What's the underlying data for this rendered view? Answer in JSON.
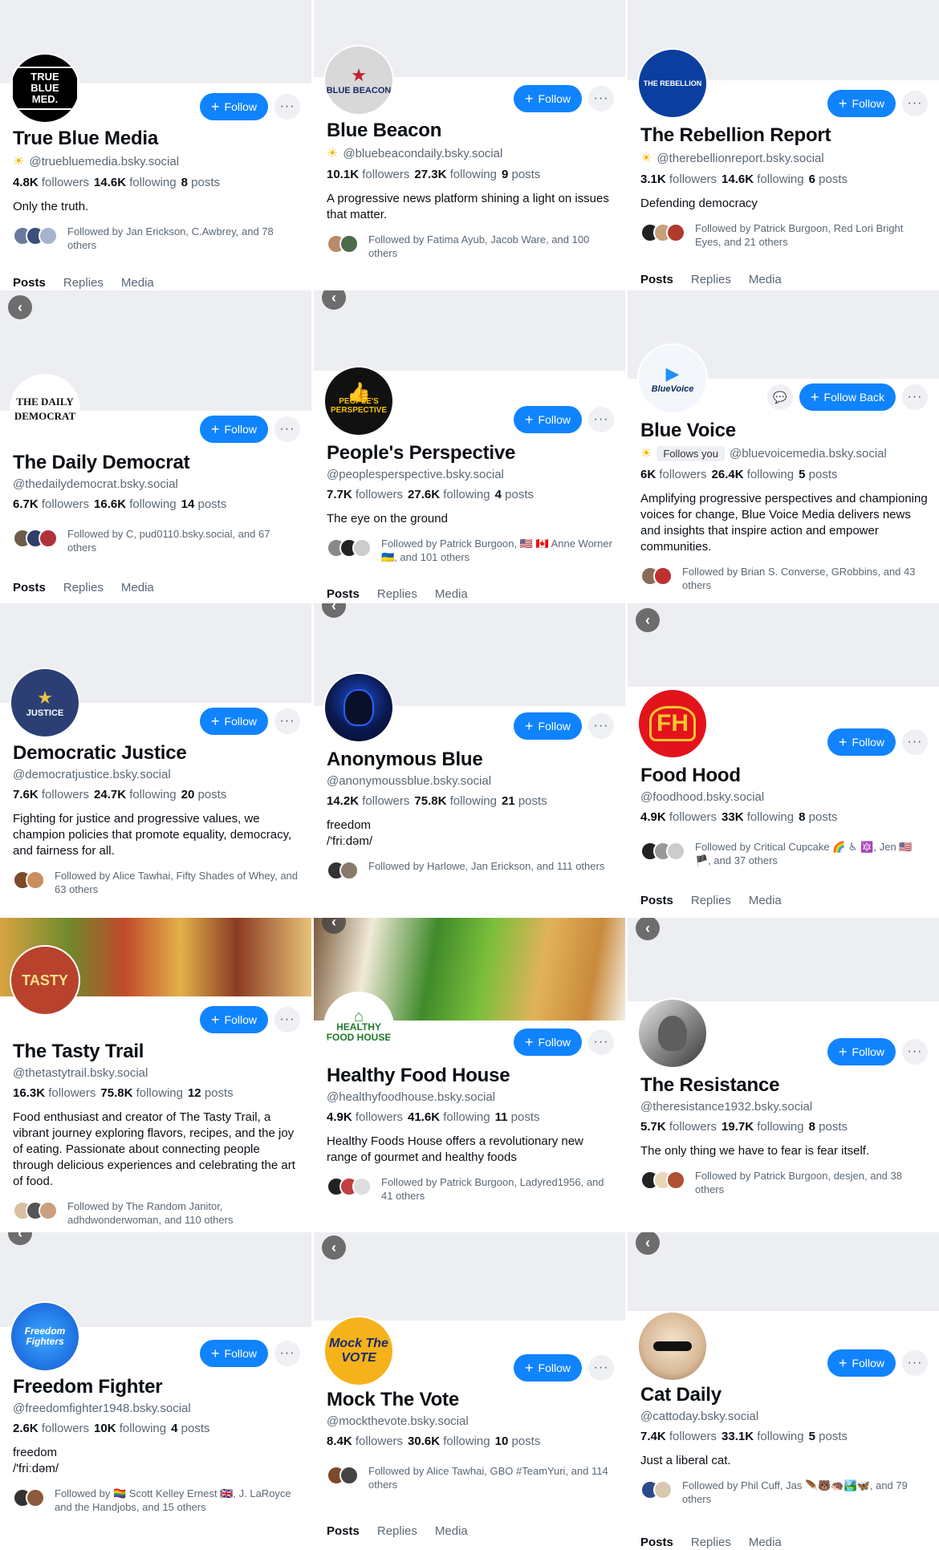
{
  "common": {
    "follow": "Follow",
    "follow_back": "Follow Back",
    "more": "···",
    "tab_posts": "Posts",
    "tab_replies": "Replies",
    "tab_media": "Media",
    "followers": "followers",
    "following": "following",
    "posts": "posts",
    "follows_you": "Follows you"
  },
  "profiles": [
    {
      "name": "True Blue Media",
      "handle": "@truebluemedia.bsky.social",
      "followers": "4.8K",
      "following": "14.6K",
      "posts": "8",
      "bio": "Only the truth.",
      "followed_by": "Followed by Jan Erickson, C.Awbrey, and 78 others",
      "avatar_text": "TRUE BLUE MED."
    },
    {
      "name": "Blue Beacon",
      "handle": "@bluebeacondaily.bsky.social",
      "followers": "10.1K",
      "following": "27.3K",
      "posts": "9",
      "bio": "A progressive news platform shining a light on issues that matter.",
      "followed_by": "Followed by Fatima Ayub, Jacob Ware, and 100 others",
      "avatar_text": "BLUE BEACON"
    },
    {
      "name": "The Rebellion Report",
      "handle": "@therebellionreport.bsky.social",
      "followers": "3.1K",
      "following": "14.6K",
      "posts": "6",
      "bio": "Defending democracy",
      "followed_by": "Followed by Patrick Burgoon, Red Lori Bright Eyes, and 21 others",
      "avatar_text": "THE REBELLION"
    },
    {
      "name": "The Daily Democrat",
      "handle": "@thedailydemocrat.bsky.social",
      "followers": "6.7K",
      "following": "16.6K",
      "posts": "14",
      "bio": "",
      "followed_by": "Followed by C, pud0110.bsky.social, and 67 others",
      "avatar_text": "THE DAILY DEMOCRAT"
    },
    {
      "name": "People's Perspective",
      "handle": "@peoplesperspective.bsky.social",
      "followers": "7.7K",
      "following": "27.6K",
      "posts": "4",
      "bio": "The eye on the ground",
      "followed_by": "Followed by Patrick Burgoon, 🇺🇸 🇨🇦 Anne Worner 🇺🇦, and 101 others",
      "avatar_text": "PEOPLE'S PERSPECTIVE"
    },
    {
      "name": "Blue Voice",
      "handle": "@bluevoicemedia.bsky.social",
      "followers": "6K",
      "following": "26.4K",
      "posts": "5",
      "bio": "Amplifying progressive perspectives and championing voices for change, Blue Voice Media delivers news and insights that inspire action and empower communities.",
      "followed_by": "Followed by Brian S. Converse, GRobbins, and 43 others",
      "avatar_text": "BlueVoice"
    },
    {
      "name": "Democratic Justice",
      "handle": "@democratjustice.bsky.social",
      "followers": "7.6K",
      "following": "24.7K",
      "posts": "20",
      "bio": "Fighting for justice and progressive values, we champion policies that promote equality, democracy, and fairness for all.",
      "followed_by": "Followed by Alice Tawhai, Fifty Shades of Whey, and 63 others",
      "avatar_text": "JUSTICE"
    },
    {
      "name": "Anonymous Blue",
      "handle": "@anonymoussblue.bsky.social",
      "followers": "14.2K",
      "following": "75.8K",
      "posts": "21",
      "bio": "freedom\n/'friːdəm/",
      "followed_by": "Followed by Harlowe, Jan Erickson, and 111 others",
      "avatar_text": ""
    },
    {
      "name": "Food Hood",
      "handle": "@foodhood.bsky.social",
      "followers": "4.9K",
      "following": "33K",
      "posts": "8",
      "bio": "",
      "followed_by": "Followed by Critical Cupcake 🌈 ♿ 🔯, Jen 🇺🇸 🏴, and 37 others",
      "avatar_text": "FH"
    },
    {
      "name": "The Tasty Trail",
      "handle": "@thetastytrail.bsky.social",
      "followers": "16.3K",
      "following": "75.8K",
      "posts": "12",
      "bio": "Food enthusiast and creator of The Tasty Trail, a vibrant journey exploring flavors, recipes, and the joy of eating. Passionate about connecting people through delicious experiences and celebrating the art of food.",
      "followed_by": "Followed by The Random Janitor, adhdwonderwoman, and 110 others",
      "avatar_text": "TASTY"
    },
    {
      "name": "Healthy Food House",
      "handle": "@healthyfoodhouse.bsky.social",
      "followers": "4.9K",
      "following": "41.6K",
      "posts": "11",
      "bio": "Healthy Foods House offers a revolutionary new range of gourmet and healthy foods",
      "followed_by": "Followed by Patrick Burgoon, Ladyred1956, and 41 others",
      "avatar_text": "HEALTHY FOOD HOUSE"
    },
    {
      "name": "The Resistance",
      "handle": "@theresistance1932.bsky.social",
      "followers": "5.7K",
      "following": "19.7K",
      "posts": "8",
      "bio": "The only thing we have to fear is fear itself.",
      "followed_by": "Followed by Patrick Burgoon, desjen, and 38 others",
      "avatar_text": ""
    },
    {
      "name": "Freedom Fighter",
      "handle": "@freedomfighter1948.bsky.social",
      "followers": "2.6K",
      "following": "10K",
      "posts": "4",
      "bio": "freedom\n/'friːdəm/",
      "followed_by": "Followed by 🏳️‍🌈 Scott Kelley Ernest 🇬🇧, J. LaRoyce and the Handjobs, and 15 others",
      "avatar_text": "Freedom Fighters"
    },
    {
      "name": "Mock The Vote",
      "handle": "@mockthevote.bsky.social",
      "followers": "8.4K",
      "following": "30.6K",
      "posts": "10",
      "bio": "",
      "followed_by": "Followed by Alice Tawhai, GBO #TeamYuri, and 114 others",
      "avatar_text": "Mock The VOTE"
    },
    {
      "name": "Cat Daily",
      "handle": "@cattoday.bsky.social",
      "followers": "7.4K",
      "following": "33.1K",
      "posts": "5",
      "bio": "Just a liberal cat.",
      "followed_by": "Followed by Phil Cuff, Jas 🪶🐻🦔🏞️🦋, and 79 others",
      "avatar_text": ""
    }
  ]
}
